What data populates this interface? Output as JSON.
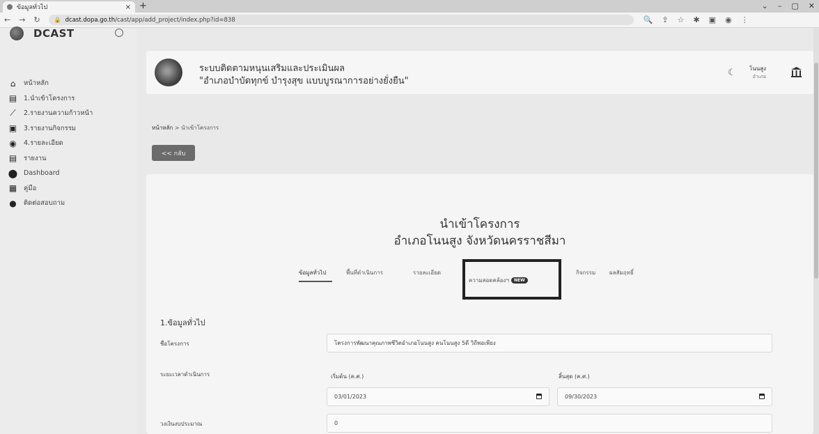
{
  "browser": {
    "tab_title": "ข้อมูลทั่วไป",
    "tab_close": "×",
    "new_tab": "+",
    "url_host": "dcast.dopa.go.th",
    "url_path": "/cast/app/add_project/index.php?id=838",
    "win_controls": [
      "⌄",
      "–",
      "▢",
      "✕"
    ]
  },
  "sidebar": {
    "brand": "DCAST",
    "items": [
      {
        "label": "หน้าหลัก",
        "icon": "home-icon"
      },
      {
        "label": "1.นำเข้าโครงการ",
        "icon": "file-import-icon"
      },
      {
        "label": "2.รายงานความก้าวหน้า",
        "icon": "chart-line-icon"
      },
      {
        "label": "3.รายงานกิจกรรม",
        "icon": "image-icon"
      },
      {
        "label": "4.รายละเอียด",
        "icon": "eye-icon"
      },
      {
        "label": "รายงาน",
        "icon": "file-report-icon"
      },
      {
        "label": "Dashboard",
        "icon": "map-pin-icon"
      },
      {
        "label": "คู่มือ",
        "icon": "book-icon"
      },
      {
        "label": "ติดต่อสอบถาม",
        "icon": "question-icon"
      }
    ]
  },
  "header": {
    "title_line1": "ระบบติดตามหนุนเสริมและประเมินผล",
    "title_line2": "\"อำเภอบำบัดทุกข์ บำรุงสุข แบบบูรณาการอย่างยั่งยืน\"",
    "user_name": "โนนสูง",
    "user_role": "อำเภอ"
  },
  "breadcrumb": {
    "home": "หน้าหลัก",
    "separator": ">",
    "current": "นำเข้าโครงการ"
  },
  "back_button": "<< กลับ",
  "main": {
    "title": "นำเข้าโครงการ",
    "subtitle": "อำเภอโนนสูง จังหวัดนครราชสีมา",
    "tabs": [
      {
        "label": "ข้อมูลทั่วไป",
        "active": true
      },
      {
        "label": "พื้นที่ดำเนินการ"
      },
      {
        "label": "รายละเอียด"
      },
      {
        "label": "ความสอดคล้องฯ",
        "badge": "NEW"
      },
      {
        "label": "กิจกรรม"
      },
      {
        "label": "ผลสัมฤทธิ์"
      }
    ],
    "section_title": "1.ข้อมูลทั่วไป",
    "fields": {
      "project_name_label": "ชื่อโครงการ",
      "project_name_value": "โครงการพัฒนาคุณภาพชีวิตอำเภอโนนสูง คนโนนสูง 5ดี วิถีพอเพียง",
      "period_label": "ระยะเวลาดำเนินการ",
      "start_label": "เริ่มต้น (ค.ศ.)",
      "start_value": "03/01/2023",
      "end_label": "สิ้นสุด (ค.ศ.)",
      "end_value": "09/30/2023",
      "budget_label": "วงเงินงบประมาณ",
      "budget_value": "0"
    }
  }
}
